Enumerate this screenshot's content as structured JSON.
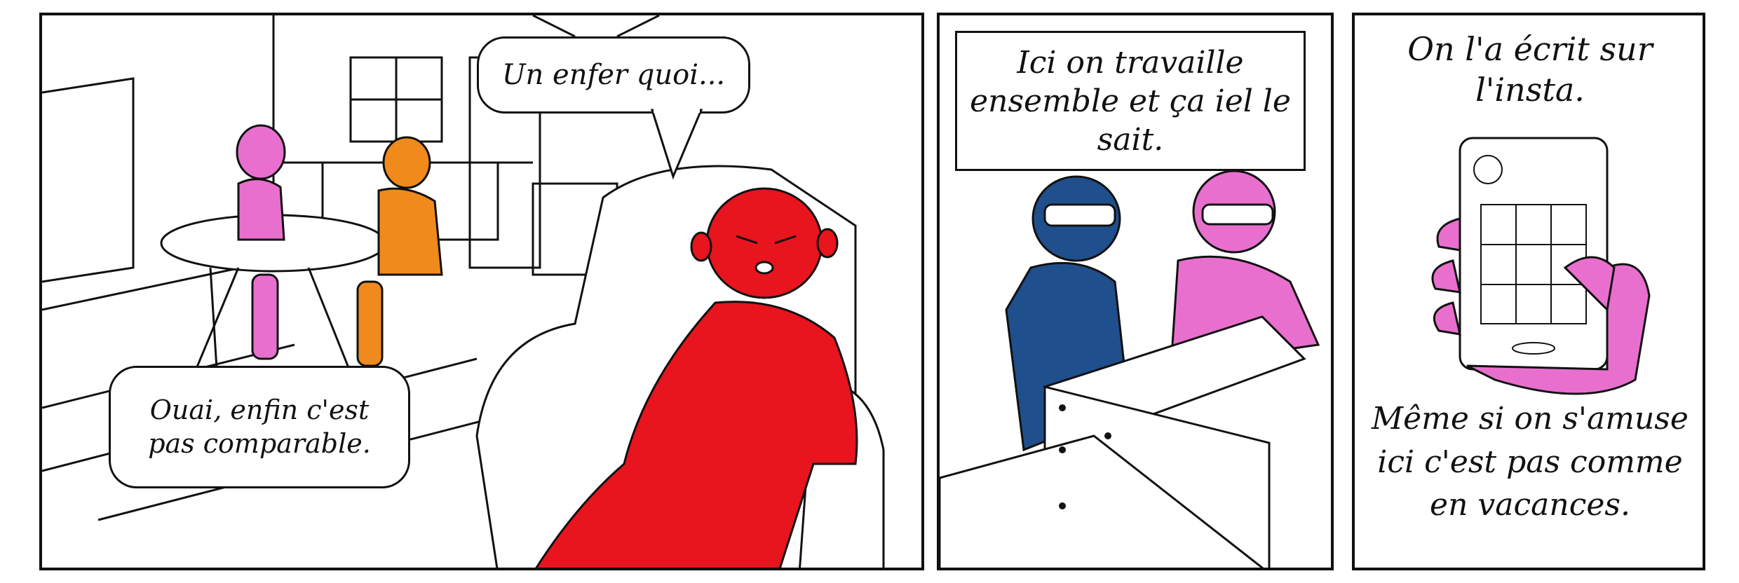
{
  "panels": [
    {
      "id": "panel-1",
      "bubbles": {
        "top_right": "Un enfer quoi...",
        "bottom_left": "Ouai, enfin c'est pas comparable."
      }
    },
    {
      "id": "panel-2",
      "caption": "Ici on travaille ensemble et ça iel le sait."
    },
    {
      "id": "panel-3",
      "caption_top": "On l'a écrit sur l'insta.",
      "caption_bottom": "Même si on s'amuse ici c'est pas comme en vacances."
    }
  ],
  "colors": {
    "red_character": "#e8141e",
    "pink_character": "#e96fcf",
    "orange_character": "#f08a1c",
    "blue_character": "#1f4f8c",
    "ink": "#111111"
  }
}
